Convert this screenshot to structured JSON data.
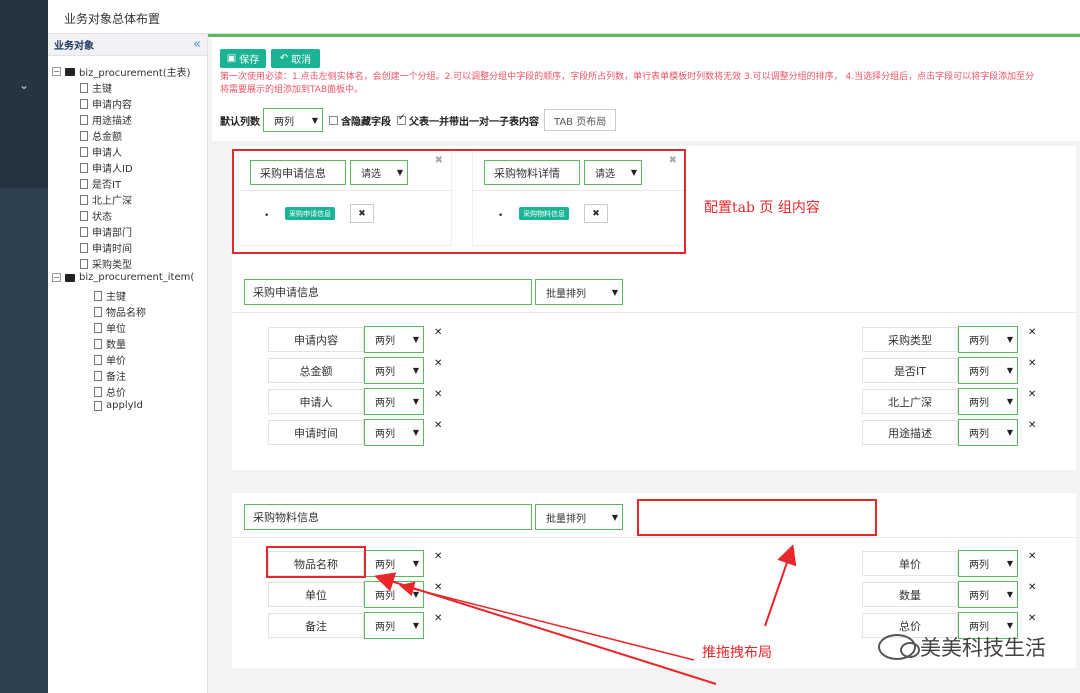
{
  "topbar": {
    "title": "业务对象总体布置"
  },
  "tree": {
    "header": "业务对象",
    "collapse_icon": "«",
    "main_table": "biz_procurement(主表)",
    "main_fields": [
      "主键",
      "申请内容",
      "用途描述",
      "总金额",
      "申请人",
      "申请人ID",
      "是否IT",
      "北上广深",
      "状态",
      "申请部门",
      "申请时间",
      "采购类型"
    ],
    "sub_table": "biz_procurement_item(",
    "sub_fields": [
      "主键",
      "物品名称",
      "单位",
      "数量",
      "单价",
      "备注",
      "总价",
      "applyId"
    ]
  },
  "toolbar": {
    "save_label": "保存",
    "cancel_label": "取消",
    "tip_line1": "第一次使用必读：1.点击左侧实体名，会创建一个分组。2.可以调整分组中字段的顺序，字段所占列数，单行表单模板时列数将无效 3.可以调整分组的排序， 4.当选择分组后，点击字段可以将字段添加至分",
    "tip_line2": "将需要展示的组添加到TAB面板中。",
    "default_cols_label": "默认列数",
    "default_cols_value": "两列",
    "hidden_fields_label": "含隐藏字段",
    "parent_child_label": "父表一并带出一对一子表内容",
    "tab_layout_button": "TAB 页布局"
  },
  "tabs": [
    {
      "name": "采购申请信息",
      "select": "请选",
      "badge": "采购申请信息"
    },
    {
      "name": "采购物料详情",
      "select": "请选",
      "badge": "采购物料信息"
    }
  ],
  "annotations": {
    "tab_config": "配置tab 页 组内容",
    "drag_layout": "推拖拽布局"
  },
  "groups": [
    {
      "name": "采购申请信息",
      "batch": "批量排列",
      "left": [
        {
          "label": "申请内容",
          "cols": "两列"
        },
        {
          "label": "总金额",
          "cols": "两列"
        },
        {
          "label": "申请人",
          "cols": "两列"
        },
        {
          "label": "申请时间",
          "cols": "两列"
        }
      ],
      "right": [
        {
          "label": "采购类型",
          "cols": "两列"
        },
        {
          "label": "是否IT",
          "cols": "两列"
        },
        {
          "label": "北上广深",
          "cols": "两列"
        },
        {
          "label": "用途描述",
          "cols": "两列"
        }
      ]
    },
    {
      "name": "采购物料信息",
      "batch": "批量排列",
      "left": [
        {
          "label": "物品名称",
          "cols": "两列"
        },
        {
          "label": "单位",
          "cols": "两列"
        },
        {
          "label": "备注",
          "cols": "两列"
        }
      ],
      "right": [
        {
          "label": "单价",
          "cols": "两列"
        },
        {
          "label": "数量",
          "cols": "两列"
        },
        {
          "label": "总价",
          "cols": "两列"
        }
      ]
    }
  ],
  "watermark": "美美科技生活",
  "colors": {
    "accent": "#1ab394",
    "select_border": "#5cb85c",
    "annotation": "#e8262c",
    "tip": "#ed5565"
  }
}
